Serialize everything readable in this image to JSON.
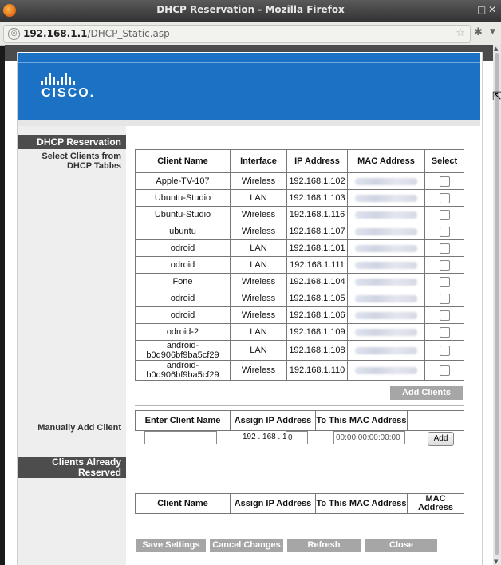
{
  "window": {
    "title": "DHCP Reservation - Mozilla Firefox",
    "controls": [
      "–",
      "□",
      "✕"
    ]
  },
  "urlbar": {
    "host": "192.168.1.1",
    "path": "/DHCP_Static.asp"
  },
  "brand": {
    "logo_text": "CISCO."
  },
  "sections": {
    "dhcp_reservation": "DHCP Reservation",
    "select_clients": "Select Clients from DHCP Tables",
    "manually_add": "Manually Add Client",
    "clients_reserved": "Clients Already Reserved"
  },
  "clients_table": {
    "headers": [
      "Client Name",
      "Interface",
      "IP Address",
      "MAC Address",
      "Select"
    ],
    "rows": [
      {
        "name": "Apple-TV-107",
        "interface": "Wireless",
        "ip": "192.168.1.102"
      },
      {
        "name": "Ubuntu-Studio",
        "interface": "LAN",
        "ip": "192.168.1.103"
      },
      {
        "name": "Ubuntu-Studio",
        "interface": "Wireless",
        "ip": "192.168.1.116"
      },
      {
        "name": "ubuntu",
        "interface": "Wireless",
        "ip": "192.168.1.107"
      },
      {
        "name": "odroid",
        "interface": "LAN",
        "ip": "192.168.1.101"
      },
      {
        "name": "odroid",
        "interface": "LAN",
        "ip": "192.168.1.111"
      },
      {
        "name": "Fone",
        "interface": "Wireless",
        "ip": "192.168.1.104"
      },
      {
        "name": "odroid",
        "interface": "Wireless",
        "ip": "192.168.1.105"
      },
      {
        "name": "odroid",
        "interface": "Wireless",
        "ip": "192.168.1.106"
      },
      {
        "name": "odroid-2",
        "interface": "LAN",
        "ip": "192.168.1.109"
      },
      {
        "name": "android-b0d906bf9ba5cf29",
        "interface": "LAN",
        "ip": "192.168.1.108"
      },
      {
        "name": "android-b0d906bf9ba5cf29",
        "interface": "Wireless",
        "ip": "192.168.1.110"
      }
    ]
  },
  "add_clients_button": "Add Clients",
  "manual_table": {
    "headers": [
      "Enter Client Name",
      "Assign IP Address",
      "To This MAC Address"
    ],
    "client_name_value": "",
    "ip_prefix": "192 . 168 . 1.",
    "ip_last_octet": "0",
    "mac_value": "00:00:00:00:00:00",
    "add_button": "Add"
  },
  "reserved_table": {
    "headers": [
      "Client Name",
      "Assign IP Address",
      "To This MAC Address",
      "MAC Address"
    ]
  },
  "footer_buttons": [
    "Save Settings",
    "Cancel Changes",
    "Refresh",
    "Close"
  ],
  "colors": {
    "banner": "#1b72c4",
    "section_header": "#4d4d4d",
    "button": "#a6a6a6"
  }
}
